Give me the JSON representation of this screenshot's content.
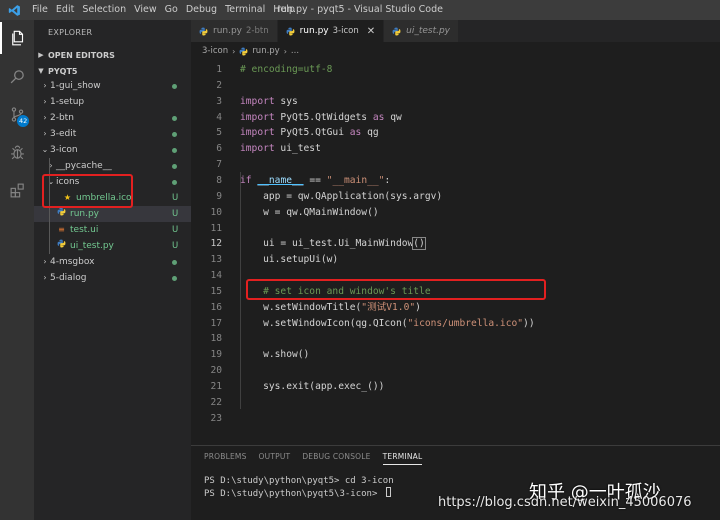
{
  "window": {
    "title": "run.py - pyqt5 - Visual Studio Code",
    "menu": [
      "File",
      "Edit",
      "Selection",
      "View",
      "Go",
      "Debug",
      "Terminal",
      "Help"
    ]
  },
  "activity_bar": {
    "icons": [
      "files-icon",
      "search-icon",
      "source-control-icon",
      "debug-icon",
      "extensions-icon"
    ],
    "scm_badge": "42"
  },
  "sidebar": {
    "title": "EXPLORER",
    "sections": {
      "open_editors": "OPEN EDITORS",
      "workspace": "PYQT5"
    },
    "tree": [
      {
        "label": "1-gui_show",
        "kind": "folder",
        "expanded": false,
        "indent": 1,
        "status": "dot"
      },
      {
        "label": "1-setup",
        "kind": "folder",
        "expanded": false,
        "indent": 1,
        "status": ""
      },
      {
        "label": "2-btn",
        "kind": "folder",
        "expanded": false,
        "indent": 1,
        "status": "dot"
      },
      {
        "label": "3-edit",
        "kind": "folder",
        "expanded": false,
        "indent": 1,
        "status": "dot"
      },
      {
        "label": "3-icon",
        "kind": "folder",
        "expanded": true,
        "indent": 1,
        "status": "dot"
      },
      {
        "label": "__pycache__",
        "kind": "folder",
        "expanded": false,
        "indent": 2,
        "status": "dot"
      },
      {
        "label": "icons",
        "kind": "folder",
        "expanded": true,
        "indent": 2,
        "status": "dot"
      },
      {
        "label": "umbrella.ico",
        "kind": "ico",
        "indent": 3,
        "status": "U"
      },
      {
        "label": "run.py",
        "kind": "py",
        "indent": 2,
        "status": "U",
        "selected": true
      },
      {
        "label": "test.ui",
        "kind": "ui",
        "indent": 2,
        "status": "U"
      },
      {
        "label": "ui_test.py",
        "kind": "py",
        "indent": 2,
        "status": "U"
      },
      {
        "label": "4-msgbox",
        "kind": "folder",
        "expanded": false,
        "indent": 1,
        "status": "dot"
      },
      {
        "label": "5-dialog",
        "kind": "folder",
        "expanded": false,
        "indent": 1,
        "status": "dot"
      }
    ]
  },
  "tabs": [
    {
      "name": "run.py",
      "dir": "2-btn",
      "active": false,
      "italic": false,
      "dirty": false
    },
    {
      "name": "run.py",
      "dir": "3-icon",
      "active": true,
      "italic": false,
      "dirty": false
    },
    {
      "name": "ui_test.py",
      "dir": "",
      "active": false,
      "italic": true,
      "dirty": false
    }
  ],
  "breadcrumbs": [
    "3-icon",
    "run.py",
    "..."
  ],
  "editor": {
    "current_line": 12,
    "lines": [
      [
        [
          "cm",
          "# encoding=utf-8"
        ]
      ],
      [],
      [
        [
          "kw",
          "import"
        ],
        [
          "op",
          " sys"
        ]
      ],
      [
        [
          "kw",
          "import"
        ],
        [
          "op",
          " PyQt5.QtWidgets "
        ],
        [
          "kw",
          "as"
        ],
        [
          "op",
          " qw"
        ]
      ],
      [
        [
          "kw",
          "import"
        ],
        [
          "op",
          " PyQt5.QtGui "
        ],
        [
          "kw",
          "as"
        ],
        [
          "op",
          " qg"
        ]
      ],
      [
        [
          "kw",
          "import"
        ],
        [
          "op",
          " ui_test"
        ]
      ],
      [],
      [
        [
          "kw",
          "if"
        ],
        [
          "op",
          " "
        ],
        [
          "dunder",
          "__name__"
        ],
        [
          "op",
          " == "
        ],
        [
          "str",
          "\"__main__\""
        ],
        [
          "op",
          ":"
        ]
      ],
      [
        [
          "op",
          "    app = qw.QApplication(sys.argv)"
        ]
      ],
      [
        [
          "op",
          "    w = qw.QMainWindow()"
        ]
      ],
      [],
      [
        [
          "op",
          "    ui = ui_test.Ui_MainWindow"
        ],
        [
          "bracket",
          "()"
        ]
      ],
      [
        [
          "op",
          "    ui.setupUi(w)"
        ]
      ],
      [],
      [
        [
          "cm",
          "    # set icon and window's title"
        ]
      ],
      [
        [
          "op",
          "    w.setWindowTitle("
        ],
        [
          "str",
          "\"测试V1.0\""
        ],
        [
          "op",
          ")"
        ]
      ],
      [
        [
          "op",
          "    w.setWindowIcon(qg.QIcon("
        ],
        [
          "str",
          "\"icons/umbrella.ico\""
        ],
        [
          "op",
          "))"
        ]
      ],
      [],
      [
        [
          "op",
          "    w.show()"
        ]
      ],
      [],
      [
        [
          "op",
          "    sys.exit(app.exec_())"
        ]
      ],
      [],
      []
    ]
  },
  "panel": {
    "tabs": [
      "PROBLEMS",
      "OUTPUT",
      "DEBUG CONSOLE",
      "TERMINAL"
    ],
    "active_tab": "TERMINAL",
    "terminal_lines": [
      "PS D:\\study\\python\\pyqt5> cd 3-icon",
      "PS D:\\study\\python\\pyqt5\\3-icon> "
    ]
  },
  "watermarks": {
    "zhihu": "知乎 @一叶孤沙",
    "csdn": "https://blog.csdn.net/weixin_45006076"
  },
  "colors": {
    "accent": "#007acc",
    "annotation": "#e32020",
    "untracked": "#73c991",
    "keyword": "#c586c0",
    "string": "#ce9178",
    "comment": "#6a9955"
  }
}
